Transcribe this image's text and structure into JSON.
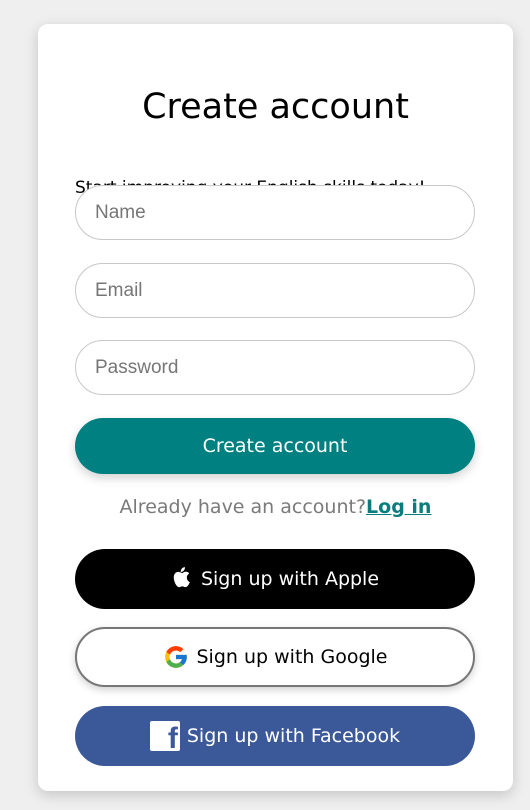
{
  "card": {
    "title": "Create account",
    "subtitle": "Start improving your English skills today!"
  },
  "form": {
    "name_placeholder": "Name",
    "email_placeholder": "Email",
    "password_placeholder": "Password",
    "submit_label": "Create account"
  },
  "login": {
    "prompt": "Already have an account?",
    "link_label": "Log in"
  },
  "social": {
    "apple_label": "Sign up with Apple",
    "google_label": "Sign up with Google",
    "facebook_label": "Sign up with Facebook"
  },
  "icons": {
    "apple": "apple-icon",
    "google": "google-icon",
    "facebook": "facebook-icon"
  },
  "colors": {
    "primary": "#008080",
    "link": "#0a7c7c",
    "apple_bg": "#000000",
    "facebook_bg": "#3b5998",
    "background": "#efefef"
  }
}
